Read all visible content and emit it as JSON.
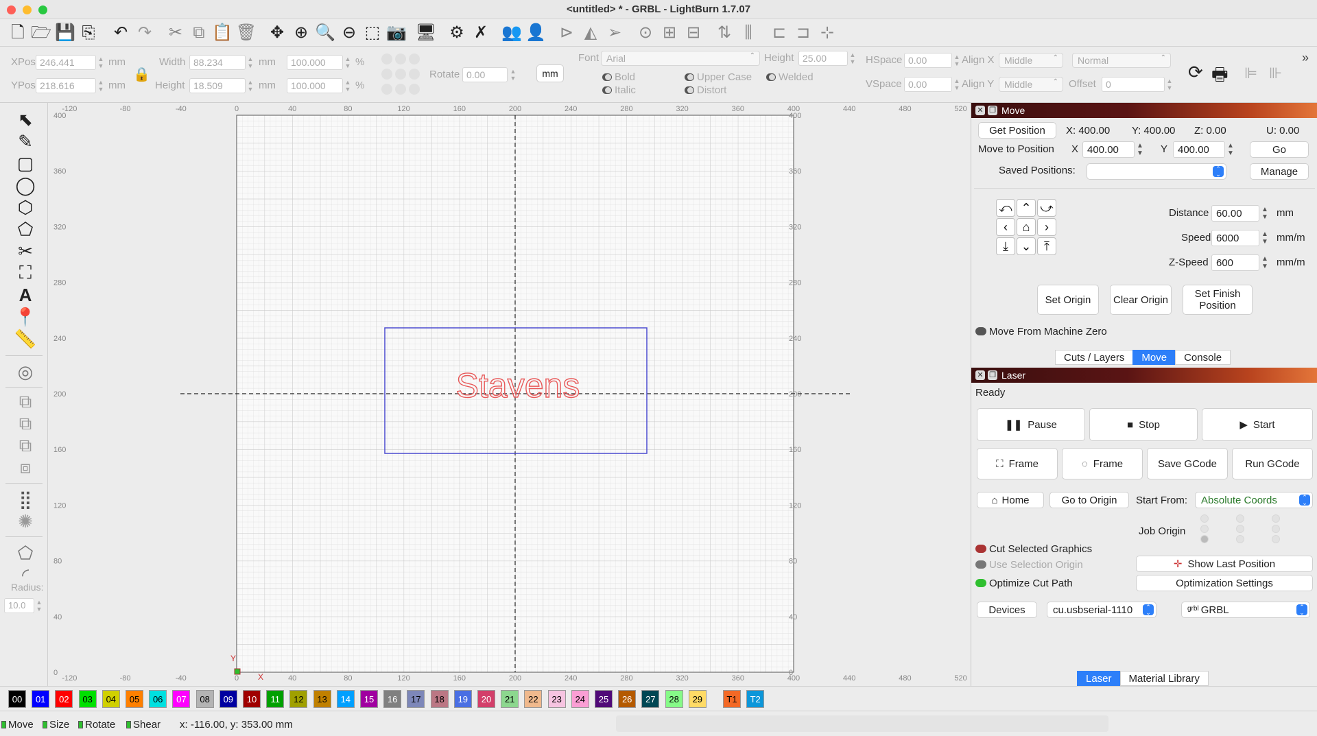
{
  "window": {
    "title": "<untitled> * - GRBL - LightBurn 1.7.07"
  },
  "toolbar": {
    "icons": [
      "new-file",
      "open-file",
      "save",
      "save-as",
      "undo",
      "redo",
      "cut",
      "copy",
      "paste",
      "delete",
      "move",
      "zoom-to-page",
      "zoom-in",
      "zoom-out",
      "zoom-frame",
      "camera",
      "monitor",
      "settings",
      "tools",
      "user-group",
      "user",
      "align-horizontal",
      "mirror",
      "send",
      "target",
      "distribute",
      "align-center",
      "flip",
      "dock-left",
      "dock-right",
      "snap"
    ]
  },
  "properties": {
    "xpos_label": "XPos",
    "xpos": "246.441",
    "ypos_label": "YPos",
    "ypos": "218.616",
    "unit_mm": "mm",
    "width_label": "Width",
    "width": "88.234",
    "height_label": "Height",
    "height": "18.509",
    "pct_w": "100.000",
    "pct_h": "100.000",
    "pct": "%",
    "rotate_label": "Rotate",
    "rotate": "0.00",
    "mm_button": "mm",
    "font_label": "Font",
    "font": "Arial",
    "font_height_label": "Height",
    "font_height": "25.00",
    "hspace_label": "HSpace",
    "hspace": "0.00",
    "vspace_label": "VSpace",
    "vspace": "0.00",
    "alignx_label": "Align X",
    "alignx": "Middle",
    "aligny_label": "Align Y",
    "aligny": "Middle",
    "style": "Normal",
    "offset_label": "Offset",
    "offset": "0",
    "bold": "Bold",
    "italic": "Italic",
    "upper_case": "Upper Case",
    "distort": "Distort",
    "welded": "Welded"
  },
  "left_tools": {
    "radius_label": "Radius:",
    "radius": "10.0"
  },
  "canvas": {
    "text_object": "Stavens",
    "x_ticks": [
      "-120",
      "-80",
      "-40",
      "0",
      "40",
      "80",
      "120",
      "160",
      "200",
      "240",
      "280",
      "320",
      "360",
      "400",
      "440",
      "480",
      "520"
    ],
    "y_ticks": [
      "400",
      "360",
      "320",
      "280",
      "240",
      "200",
      "160",
      "120",
      "80",
      "40",
      "0"
    ],
    "axis_x": "X",
    "axis_y": "Y"
  },
  "move_panel": {
    "title": "Move",
    "get_position": "Get Position",
    "pos_x": "X: 400.00",
    "pos_y": "Y: 400.00",
    "pos_z": "Z: 0.00",
    "pos_u": "U: 0.00",
    "move_to_position": "Move to Position",
    "x_label": "X",
    "x_value": "400.00",
    "y_label": "Y",
    "y_value": "400.00",
    "go": "Go",
    "saved_positions": "Saved Positions:",
    "manage": "Manage",
    "distance_label": "Distance",
    "distance": "60.00",
    "distance_unit": "mm",
    "speed_label": "Speed",
    "speed": "6000",
    "speed_unit": "mm/m",
    "zspeed_label": "Z-Speed",
    "zspeed": "600",
    "zspeed_unit": "mm/m",
    "set_origin": "Set Origin",
    "clear_origin": "Clear Origin",
    "set_finish": "Set Finish Position",
    "move_from_zero": "Move From Machine Zero",
    "tabs": [
      "Cuts / Layers",
      "Move",
      "Console"
    ],
    "active_tab": "Move"
  },
  "laser_panel": {
    "title": "Laser",
    "status": "Ready",
    "pause": "Pause",
    "stop": "Stop",
    "start": "Start",
    "frame1": "Frame",
    "frame2": "Frame",
    "save_gcode": "Save GCode",
    "run_gcode": "Run GCode",
    "home": "Home",
    "go_to_origin": "Go to Origin",
    "start_from_label": "Start From:",
    "start_from": "Absolute Coords",
    "job_origin": "Job Origin",
    "cut_selected": "Cut Selected Graphics",
    "use_selection_origin": "Use Selection Origin",
    "optimize_cut_path": "Optimize Cut Path",
    "show_last_position": "Show Last Position",
    "optimization_settings": "Optimization Settings",
    "devices": "Devices",
    "port": "cu.usbserial-1110",
    "device_prefix": "grbl",
    "device": "GRBL",
    "bottom_tabs": [
      "Laser",
      "Material Library"
    ],
    "active_bottom_tab": "Laser"
  },
  "palette": [
    {
      "label": "00",
      "bg": "#000000",
      "fg": "#ffffff"
    },
    {
      "label": "01",
      "bg": "#0000ff",
      "fg": "#ffffff"
    },
    {
      "label": "02",
      "bg": "#ff0000",
      "fg": "#ffffff"
    },
    {
      "label": "03",
      "bg": "#00e000",
      "fg": "#000000"
    },
    {
      "label": "04",
      "bg": "#d0d000",
      "fg": "#000000"
    },
    {
      "label": "05",
      "bg": "#ff8000",
      "fg": "#000000"
    },
    {
      "label": "06",
      "bg": "#00e0e0",
      "fg": "#000000"
    },
    {
      "label": "07",
      "bg": "#ff00ff",
      "fg": "#ffffff"
    },
    {
      "label": "08",
      "bg": "#b4b4b4",
      "fg": "#000000"
    },
    {
      "label": "09",
      "bg": "#0000a0",
      "fg": "#ffffff"
    },
    {
      "label": "10",
      "bg": "#a00000",
      "fg": "#ffffff"
    },
    {
      "label": "11",
      "bg": "#00a000",
      "fg": "#ffffff"
    },
    {
      "label": "12",
      "bg": "#a0a000",
      "fg": "#000000"
    },
    {
      "label": "13",
      "bg": "#c08000",
      "fg": "#000000"
    },
    {
      "label": "14",
      "bg": "#00a0ff",
      "fg": "#ffffff"
    },
    {
      "label": "15",
      "bg": "#a000a0",
      "fg": "#ffffff"
    },
    {
      "label": "16",
      "bg": "#808080",
      "fg": "#ffffff"
    },
    {
      "label": "17",
      "bg": "#7d87b9",
      "fg": "#000000"
    },
    {
      "label": "18",
      "bg": "#bb7784",
      "fg": "#000000"
    },
    {
      "label": "19",
      "bg": "#4a6fe3",
      "fg": "#ffffff"
    },
    {
      "label": "20",
      "bg": "#d33f6a",
      "fg": "#ffffff"
    },
    {
      "label": "21",
      "bg": "#8cd78e",
      "fg": "#000000"
    },
    {
      "label": "22",
      "bg": "#f0b98d",
      "fg": "#000000"
    },
    {
      "label": "23",
      "bg": "#f6c4e1",
      "fg": "#000000"
    },
    {
      "label": "24",
      "bg": "#fa9ed4",
      "fg": "#000000"
    },
    {
      "label": "25",
      "bg": "#500a78",
      "fg": "#ffffff"
    },
    {
      "label": "26",
      "bg": "#b45a00",
      "fg": "#ffffff"
    },
    {
      "label": "27",
      "bg": "#004754",
      "fg": "#ffffff"
    },
    {
      "label": "28",
      "bg": "#86fa88",
      "fg": "#000000"
    },
    {
      "label": "29",
      "bg": "#ffdb66",
      "fg": "#000000"
    },
    {
      "label": "T1",
      "bg": "#f36926",
      "fg": "#000000"
    },
    {
      "label": "T2",
      "bg": "#0c96d9",
      "fg": "#ffffff"
    }
  ],
  "statusbar": {
    "move": "Move",
    "size": "Size",
    "rotate": "Rotate",
    "shear": "Shear",
    "coords": "x: -116.00, y: 353.00 mm"
  },
  "colors": {
    "accent": "#2d7ff9",
    "selection_box": "#4a4ad0",
    "text_object": "#e85a5a"
  }
}
